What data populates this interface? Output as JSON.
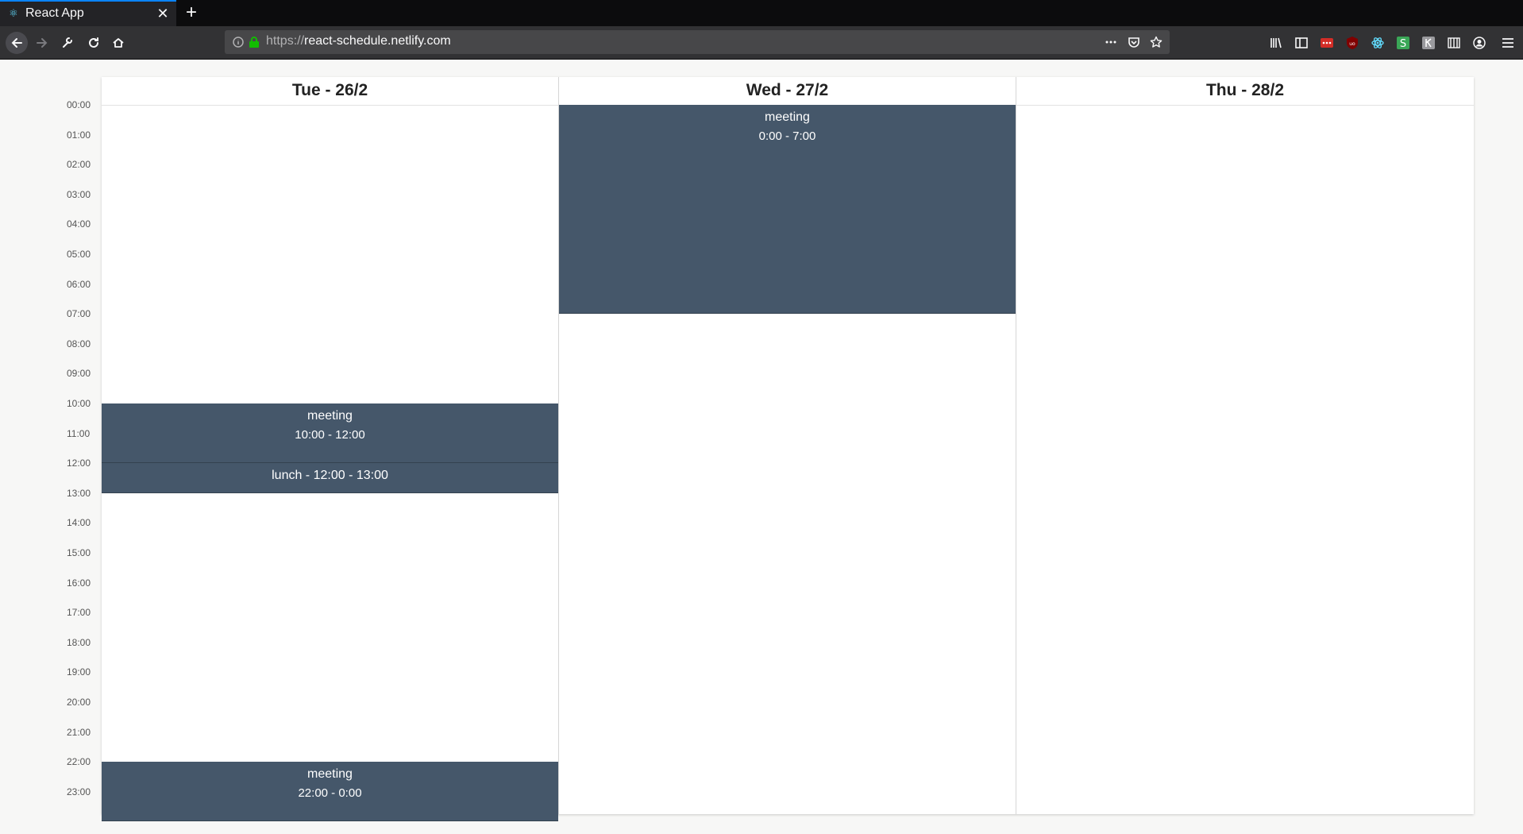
{
  "browser": {
    "tab_title": "React App",
    "url_scheme": "https://",
    "url_host": "react-schedule.netlify.com"
  },
  "hours": [
    "00:00",
    "01:00",
    "02:00",
    "03:00",
    "04:00",
    "05:00",
    "06:00",
    "07:00",
    "08:00",
    "09:00",
    "10:00",
    "11:00",
    "12:00",
    "13:00",
    "14:00",
    "15:00",
    "16:00",
    "17:00",
    "18:00",
    "19:00",
    "20:00",
    "21:00",
    "22:00",
    "23:00"
  ],
  "days": [
    {
      "label": "Tue - 26/2",
      "events": [
        {
          "title": "meeting",
          "time": "10:00 - 12:00",
          "start": 10,
          "end": 12
        },
        {
          "label": "lunch - 12:00 - 13:00",
          "start": 12,
          "end": 13
        },
        {
          "title": "meeting",
          "time": "22:00 - 0:00",
          "start": 22,
          "end": 24
        }
      ]
    },
    {
      "label": "Wed - 27/2",
      "events": [
        {
          "title": "meeting",
          "time": "0:00 - 7:00",
          "start": 0,
          "end": 7
        }
      ]
    },
    {
      "label": "Thu - 28/2",
      "events": []
    }
  ],
  "colors": {
    "event_bg": "#45576a",
    "tab_accent": "#0a84ff",
    "lock_green": "#12bc00"
  }
}
